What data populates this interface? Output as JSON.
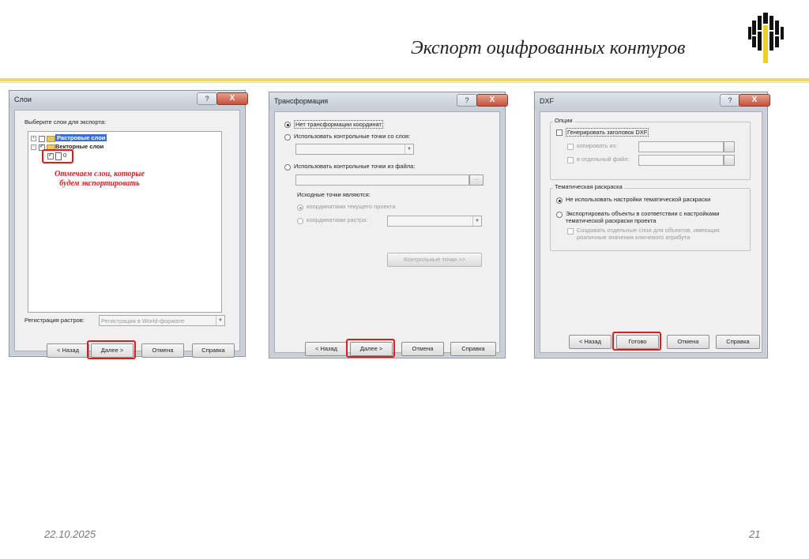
{
  "slide": {
    "title": "Экспорт оцифрованных контуров",
    "date": "22.10.2025",
    "page": "21",
    "logo_icon": "rosneft-logo-icon",
    "accent_color": "#f3d36b",
    "highlight_color": "#e01b1b"
  },
  "dialog_layers": {
    "title": "Слои",
    "help_glyph": "?",
    "close_glyph": "X",
    "prompt": "Выберите слои для экспорта:",
    "tree": {
      "raster_label": "Растровые слои",
      "vector_label": "Векторные слои",
      "layer_label": "0"
    },
    "note": [
      "Отмечаем слои, которые",
      "будем экспортировать"
    ],
    "raster_reg_label": "Регистрация растров:",
    "raster_reg_value": "Регистрация в World-формате",
    "buttons": {
      "back": "< Назад",
      "next": "Далее >",
      "cancel": "Отмена",
      "help": "Справка"
    }
  },
  "dialog_transform": {
    "title": "Трансформация",
    "help_glyph": "?",
    "close_glyph": "X",
    "opt_none": "Нет трансформации координат",
    "opt_layer": "Использовать контрольные точки со слоя:",
    "opt_file": "Использовать контрольные точки из файла:",
    "browse_glyph": "...",
    "source_label": "Исходные точки являются:",
    "src_project": "координатами текущего проекта",
    "src_raster": "координатами растра:",
    "ctrl_points_btn": "Контрольные точки >>",
    "buttons": {
      "back": "< Назад",
      "next": "Далее >",
      "cancel": "Отмена",
      "help": "Справка"
    }
  },
  "dialog_dxf": {
    "title": "DXF",
    "help_glyph": "?",
    "close_glyph": "X",
    "options_group": "Опции",
    "gen_header": "Генерировать заголовок DXF",
    "copy_from": "копировать из:",
    "separate_file": "в отдельный файл:",
    "thematic_group": "Тематическая раскраска",
    "opt_no_thematic": "Не использовать настройки тематической раскраски",
    "opt_export_thematic_1": "Экспортировать объекты в соответствии с настройками",
    "opt_export_thematic_2": "тематической раскраски проекта",
    "create_layers_1": "Создавать отдельные слои для объектов, имеющих",
    "create_layers_2": "различные значения ключевого атрибута",
    "buttons": {
      "back": "< Назад",
      "finish": "Готово",
      "cancel": "Отмена",
      "help": "Справка"
    }
  }
}
